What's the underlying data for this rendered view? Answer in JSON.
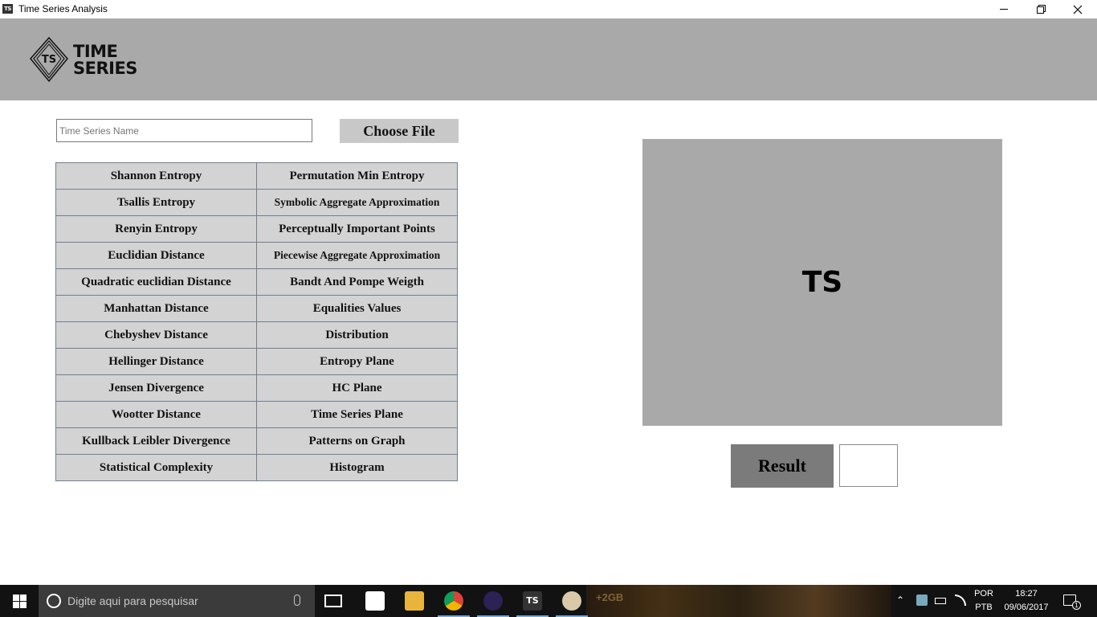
{
  "window": {
    "icon_label": "TS",
    "title": "Time Series Analysis",
    "minimize": "—",
    "restore": "❐",
    "close": "✕"
  },
  "logo": {
    "badge": "TS",
    "line1": "TIME",
    "line2": "SERIES"
  },
  "controls": {
    "name_placeholder": "Time Series Name",
    "choose_file": "Choose File"
  },
  "buttons": [
    [
      "Shannon Entropy",
      "Permutation Min Entropy"
    ],
    [
      "Tsallis Entropy",
      "Symbolic Aggregate  Approximation"
    ],
    [
      "Renyin Entropy",
      "Perceptually Important Points"
    ],
    [
      "Euclidian Distance",
      "Piecewise Aggregate Approximation"
    ],
    [
      "Quadratic euclidian Distance",
      "Bandt And Pompe Weigth"
    ],
    [
      "Manhattan Distance",
      "Equalities Values"
    ],
    [
      "Chebyshev Distance",
      "Distribution"
    ],
    [
      "Hellinger Distance",
      "Entropy Plane"
    ],
    [
      "Jensen Divergence",
      "HC Plane"
    ],
    [
      "Wootter Distance",
      "Time Series Plane"
    ],
    [
      "Kullback Leibler Divergence",
      "Patterns on Graph"
    ],
    [
      "Statistical Complexity",
      "Histogram"
    ]
  ],
  "preview": {
    "label": "TS"
  },
  "result": {
    "label": "Result",
    "value": ""
  },
  "taskbar": {
    "search_placeholder": "Digite aqui para pesquisar",
    "lang1": "POR",
    "lang2": "PTB",
    "time": "18:27",
    "date": "09/06/2017",
    "notif_count": "1",
    "wallpaper_text": "+2GB"
  }
}
